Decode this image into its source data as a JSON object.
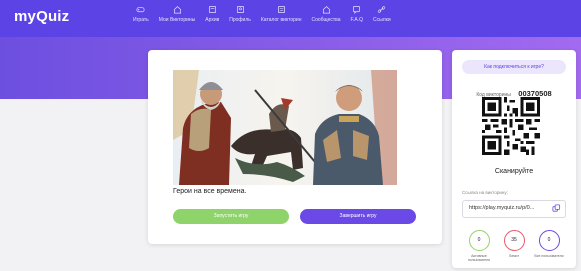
{
  "app": {
    "logo": "myQuiz"
  },
  "nav": [
    {
      "label": "Играть",
      "icon": "gamepad-icon"
    },
    {
      "label": "Мои Викторины",
      "icon": "home-icon"
    },
    {
      "label": "Архив",
      "icon": "archive-icon"
    },
    {
      "label": "Профиль",
      "icon": "user-icon"
    },
    {
      "label": "Каталог викторин",
      "icon": "catalog-icon"
    },
    {
      "label": "Сообщества",
      "icon": "community-icon"
    },
    {
      "label": "F.A.Q",
      "icon": "faq-icon"
    },
    {
      "label": "Ссылки",
      "icon": "link-icon"
    }
  ],
  "quiz": {
    "title": "Герои на все времена.",
    "start_label": "Запустить игру",
    "end_label": "Завершить игру"
  },
  "side": {
    "how_label": "Как подключиться к игре?",
    "code_label": "Код викторины",
    "code_value": "00370508",
    "scan_label": "Сканируйте",
    "link_label": "Ссылка на викторину:",
    "link_value": "https://play.myquiz.ru/p/0..."
  },
  "stats": [
    {
      "value": "0",
      "label": "Активные пользователи",
      "color": "#8ed46a"
    },
    {
      "value": "35",
      "label": "Лимит",
      "color": "#e85a6c"
    },
    {
      "value": "0",
      "label": "Все пользователи",
      "color": "#6b49e6"
    }
  ],
  "colors": {
    "brand": "#5b43e6",
    "start": "#8ed46a",
    "end": "#6b49e6"
  }
}
